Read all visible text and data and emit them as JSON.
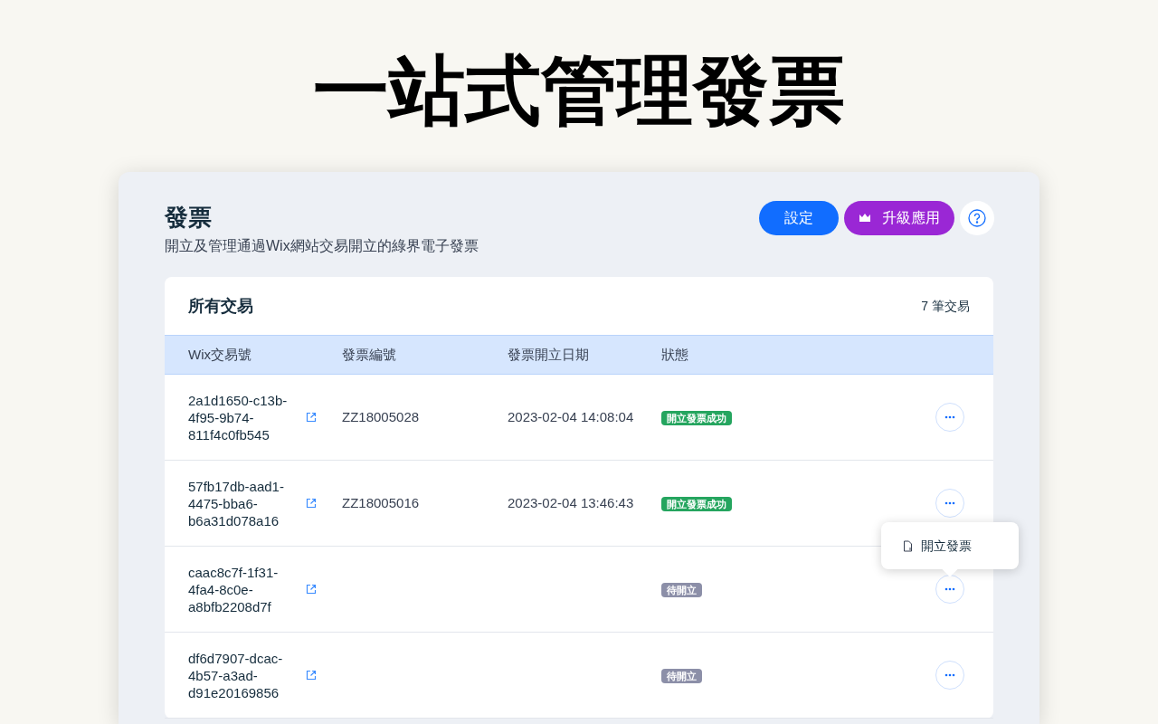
{
  "headline": "一站式管理發票",
  "page": {
    "title": "發票",
    "subtitle": "開立及管理通過Wix網站交易開立的綠界電子發票"
  },
  "buttons": [
    {
      "label": "設定",
      "kind": "settings"
    },
    {
      "label": "升級應用",
      "kind": "upgrade"
    }
  ],
  "table": {
    "title": "所有交易",
    "count": "7 筆交易",
    "columns": [
      "Wix交易號",
      "發票編號",
      "發票開立日期",
      "狀態"
    ],
    "rows": [
      {
        "transaction": "2a1d1650-c13b-4f95-9b74-811f4c0fb545",
        "invoice": "ZZ18005028",
        "date": "2023-02-04 14:08:04",
        "status": {
          "label": "開立發票成功",
          "kind": "success"
        }
      },
      {
        "transaction": "57fb17db-aad1-4475-bba6-b6a31d078a16",
        "invoice": "ZZ18005016",
        "date": "2023-02-04 13:46:43",
        "status": {
          "label": "開立發票成功",
          "kind": "success"
        }
      },
      {
        "transaction": "caac8c7f-1f31-4fa4-8c0e-a8bfb2208d7f",
        "status": {
          "label": "待開立",
          "kind": "pending"
        },
        "menu": [
          "開立發票"
        ]
      },
      {
        "transaction": "df6d7907-dcac-4b57-a3ad-d91e20169856",
        "status": {
          "label": "待開立",
          "kind": "pending"
        }
      }
    ]
  }
}
